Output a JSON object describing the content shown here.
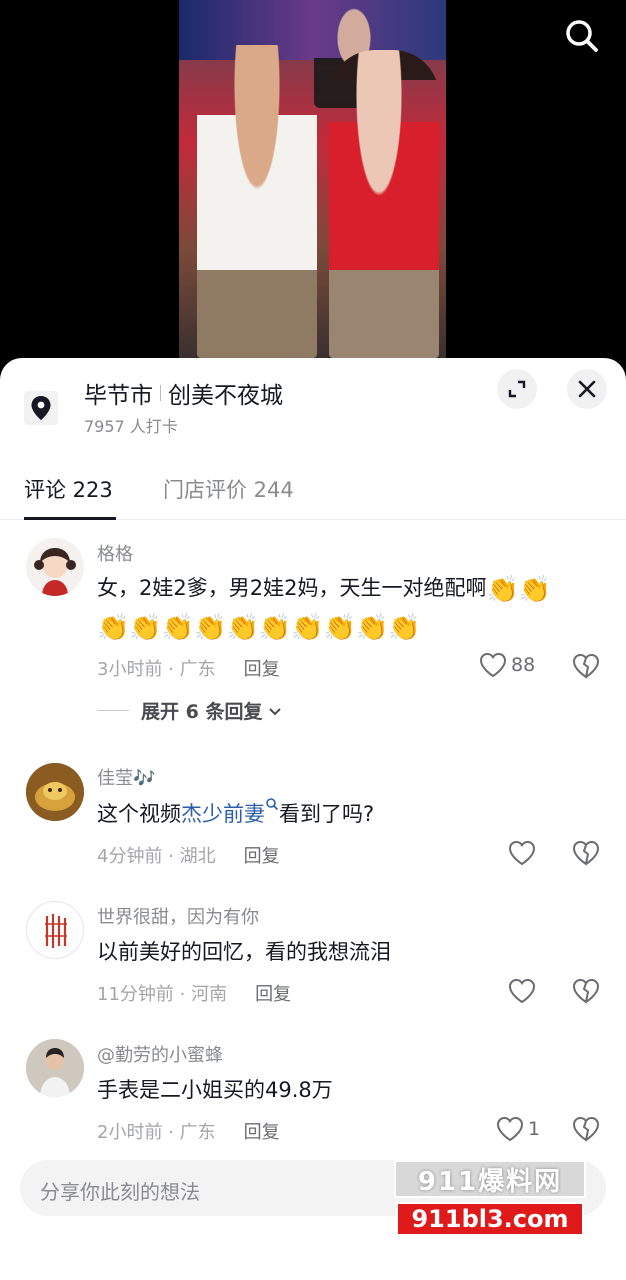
{
  "location": {
    "city": "毕节市",
    "place": "创美不夜城",
    "checkins": "7957 人打卡"
  },
  "tabs": {
    "comments": "评论 223",
    "store_reviews": "门店评价 244"
  },
  "comments": [
    {
      "user": "格格",
      "text_lines": [
        "女，2娃2爹，男2娃2妈，天生一对绝配啊",
        ""
      ],
      "claps_line1": "👏👏",
      "claps_line2": "👏👏👏👏👏👏👏👏👏👏",
      "time": "3小时前 · 广东",
      "reply_label": "回复",
      "likes": "88",
      "expand": "展开 6 条回复"
    },
    {
      "user": "佳莹",
      "user_decor": "🎶",
      "text_before": "这个视频",
      "text_link": "杰少前妻",
      "text_after": "看到了吗?",
      "time": "4分钟前 · 湖北",
      "reply_label": "回复"
    },
    {
      "user": "世界很甜，因为有你",
      "text": "以前美好的回忆，看的我想流泪",
      "time": "11分钟前 · 河南",
      "reply_label": "回复"
    },
    {
      "user": "@勤劳的小蜜蜂",
      "text": "手表是二小姐买的49.8万",
      "time": "2小时前 · 广东",
      "reply_label": "回复",
      "likes": "1"
    }
  ],
  "input": {
    "placeholder": "分享你此刻的想法"
  },
  "watermark": {
    "top": "911爆料网",
    "bottom": "911bl3.com"
  },
  "colors": {
    "accent_link": "#2d5fa8",
    "watermark_red": "#e01a1a"
  }
}
